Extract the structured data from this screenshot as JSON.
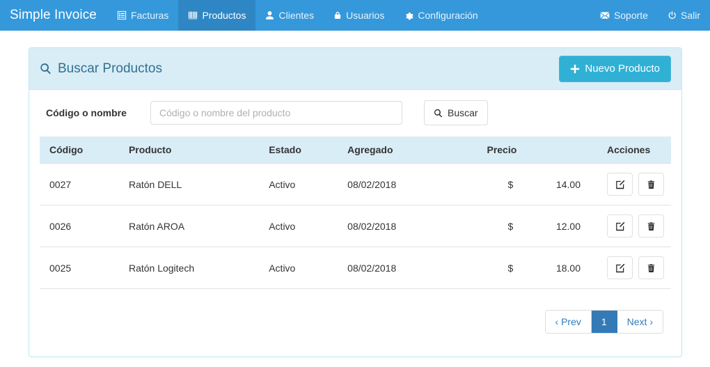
{
  "navbar": {
    "brand": "Simple Invoice",
    "items": [
      {
        "label": "Facturas",
        "icon": "list-alt-icon",
        "active": false
      },
      {
        "label": "Productos",
        "icon": "barcode-icon",
        "active": true
      },
      {
        "label": "Clientes",
        "icon": "user-icon",
        "active": false
      },
      {
        "label": "Usuarios",
        "icon": "lock-icon",
        "active": false
      },
      {
        "label": "Configuración",
        "icon": "gear-icon",
        "active": false
      }
    ],
    "right_items": [
      {
        "label": "Soporte",
        "icon": "envelope-icon"
      },
      {
        "label": "Salir",
        "icon": "power-off-icon"
      }
    ],
    "bg_color": "#3498db",
    "active_bg_color": "#2e87c4"
  },
  "panel": {
    "title": "Buscar Productos",
    "title_icon": "search-icon",
    "heading_bg": "#d9edf7",
    "heading_color": "#31708f",
    "new_button": {
      "label": "Nuevo Producto",
      "icon": "plus-icon",
      "color": "#31b0d5"
    }
  },
  "search": {
    "label": "Código o nombre",
    "value": "",
    "placeholder": "Código o nombre del producto",
    "button_label": "Buscar",
    "button_icon": "search-icon"
  },
  "table": {
    "columns": [
      "Código",
      "Producto",
      "Estado",
      "Agregado",
      "Precio",
      "Acciones"
    ],
    "rows": [
      {
        "codigo": "0027",
        "producto": "Ratón DELL",
        "estado": "Activo",
        "agregado": "08/02/2018",
        "moneda": "$",
        "precio": "14.00"
      },
      {
        "codigo": "0026",
        "producto": "Ratón AROA",
        "estado": "Activo",
        "agregado": "08/02/2018",
        "moneda": "$",
        "precio": "12.00"
      },
      {
        "codigo": "0025",
        "producto": "Ratón Logitech",
        "estado": "Activo",
        "agregado": "08/02/2018",
        "moneda": "$",
        "precio": "18.00"
      }
    ],
    "row_actions": [
      {
        "name": "edit-button",
        "icon": "pencil-square-icon"
      },
      {
        "name": "delete-button",
        "icon": "trash-icon"
      }
    ]
  },
  "pagination": {
    "prev_label": "‹ Prev",
    "next_label": "Next ›",
    "pages": [
      "1"
    ],
    "current_page": "1",
    "active_color": "#337ab7"
  }
}
